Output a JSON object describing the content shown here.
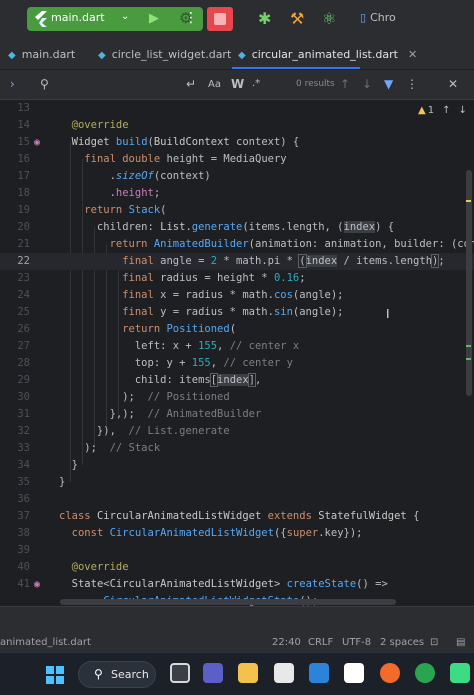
{
  "toolbar": {
    "run_config": "main.dart",
    "device_label": "Chro"
  },
  "tabs": [
    {
      "label": "main.dart"
    },
    {
      "label": "circle_list_widget.dart"
    },
    {
      "label": "circular_animated_list.dart",
      "close": "✕"
    }
  ],
  "find": {
    "results": "0 results",
    "match_case": "Aa",
    "words": "W",
    "regex": ".*"
  },
  "inspections": {
    "warnings": "1"
  },
  "editor": {
    "line_numbers": [
      "13",
      "14",
      "15",
      "16",
      "17",
      "18",
      "19",
      "20",
      "21",
      "22",
      "23",
      "24",
      "25",
      "26",
      "27",
      "28",
      "29",
      "30",
      "31",
      "32",
      "33",
      "34",
      "35",
      "36",
      "37",
      "38",
      "39",
      "40",
      "41",
      ""
    ],
    "current_line": "22"
  },
  "statusbar": {
    "file": "animated_list.dart",
    "position": "22:40",
    "line_sep": "CRLF",
    "encoding": "UTF-8",
    "indent": "2 spaces"
  },
  "taskbar": {
    "search_label": "Search"
  },
  "colors": {
    "run_green": "#4a9a3f",
    "stop_red": "#e5474d",
    "keyword": "#cf8e6d",
    "function": "#56a8f5",
    "number": "#2aacb8",
    "comment": "#7a7e85",
    "annotation": "#b3ae60",
    "tab_accent": "#3574f0"
  }
}
